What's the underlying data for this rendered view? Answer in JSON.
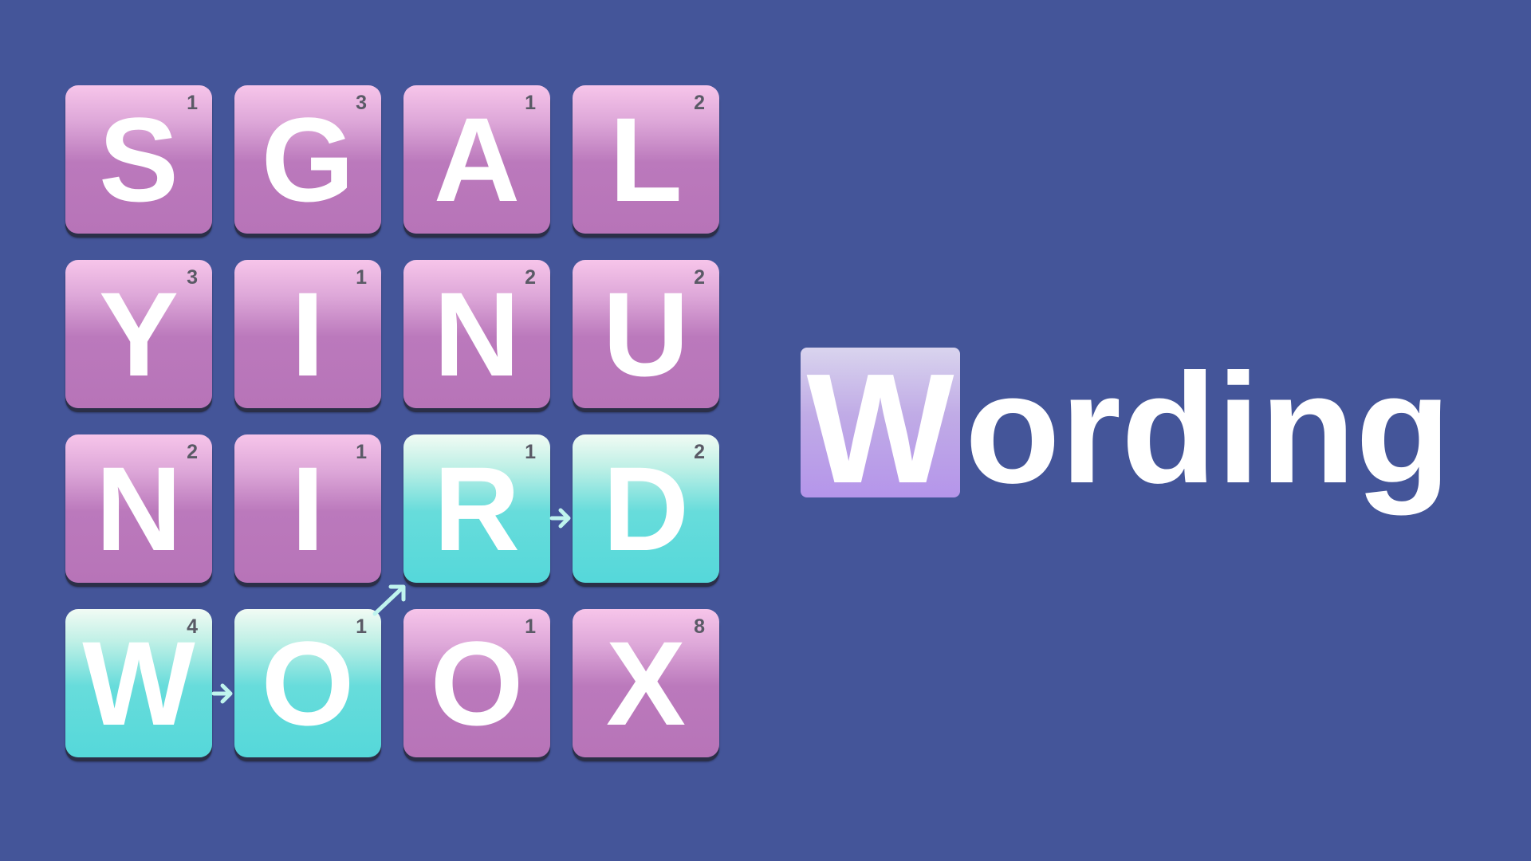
{
  "logo": {
    "first_letter": "W",
    "rest": "ording"
  },
  "board": {
    "tiles": [
      {
        "letter": "S",
        "score": "1",
        "selected": false
      },
      {
        "letter": "G",
        "score": "3",
        "selected": false
      },
      {
        "letter": "A",
        "score": "1",
        "selected": false
      },
      {
        "letter": "L",
        "score": "2",
        "selected": false
      },
      {
        "letter": "Y",
        "score": "3",
        "selected": false
      },
      {
        "letter": "I",
        "score": "1",
        "selected": false
      },
      {
        "letter": "N",
        "score": "2",
        "selected": false
      },
      {
        "letter": "U",
        "score": "2",
        "selected": false
      },
      {
        "letter": "N",
        "score": "2",
        "selected": false
      },
      {
        "letter": "I",
        "score": "1",
        "selected": false
      },
      {
        "letter": "R",
        "score": "1",
        "selected": true
      },
      {
        "letter": "D",
        "score": "2",
        "selected": true
      },
      {
        "letter": "W",
        "score": "4",
        "selected": true
      },
      {
        "letter": "O",
        "score": "1",
        "selected": true
      },
      {
        "letter": "O",
        "score": "1",
        "selected": false
      },
      {
        "letter": "X",
        "score": "8",
        "selected": false
      }
    ]
  },
  "colors": {
    "background": "#445599",
    "tile_pink": "#b774b8",
    "tile_selected": "#55d8da",
    "logo_tile": "#b595ea",
    "arrow": "#bff4ee",
    "score_text": "#5a5a66"
  },
  "path_icons": [
    "arrow-right-icon",
    "arrow-up-right-icon",
    "arrow-right-icon"
  ]
}
